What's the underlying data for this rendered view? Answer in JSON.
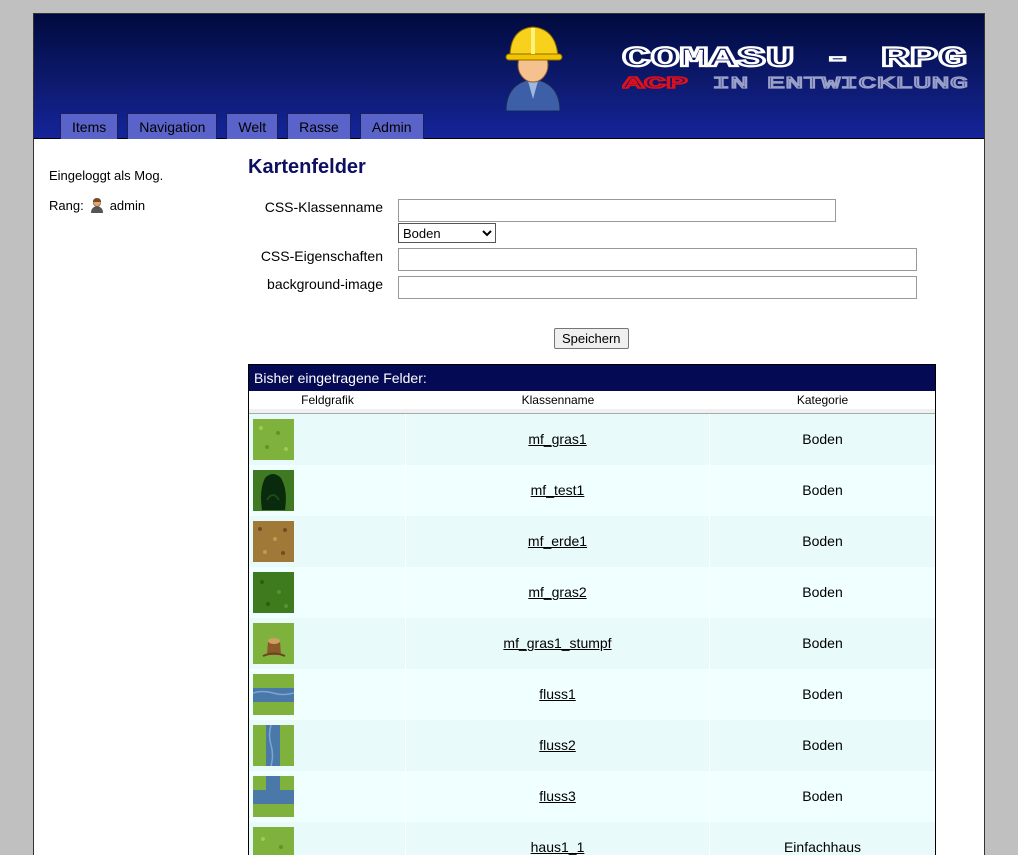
{
  "header": {
    "title": "COMASU - RPG",
    "subtitle_acp": "ACP",
    "subtitle_status": "IN ENTWICKLUNG"
  },
  "nav": {
    "items": [
      "Items",
      "Navigation",
      "Welt",
      "Rasse",
      "Admin"
    ]
  },
  "sidebar": {
    "login_text": "Eingeloggt als Mog.",
    "rank_label": "Rang:",
    "rank_value": "admin"
  },
  "main": {
    "title": "Kartenfelder",
    "form": {
      "css_class_label": "CSS-Klassenname",
      "css_class_value": "",
      "category_selected": "Boden",
      "css_props_label": "CSS-Eigenschaften",
      "css_props_value": "",
      "bg_image_label": "background-image",
      "bg_image_value": "",
      "save_label": "Speichern"
    },
    "table": {
      "caption": "Bisher eingetragene Felder:",
      "columns": [
        "Feldgrafik",
        "Klassenname",
        "Kategorie"
      ],
      "rows": [
        {
          "class_name": "mf_gras1",
          "category": "Boden",
          "tile": "grass"
        },
        {
          "class_name": "mf_test1",
          "category": "Boden",
          "tile": "dark-tree"
        },
        {
          "class_name": "mf_erde1",
          "category": "Boden",
          "tile": "dirt"
        },
        {
          "class_name": "mf_gras2",
          "category": "Boden",
          "tile": "dark-grass"
        },
        {
          "class_name": "mf_gras1_stumpf",
          "category": "Boden",
          "tile": "grass-stump"
        },
        {
          "class_name": "fluss1",
          "category": "Boden",
          "tile": "river-horizontal"
        },
        {
          "class_name": "fluss2",
          "category": "Boden",
          "tile": "river-vertical"
        },
        {
          "class_name": "fluss3",
          "category": "Boden",
          "tile": "river-corner"
        },
        {
          "class_name": "haus1_1",
          "category": "Einfachhaus",
          "tile": "house-grass"
        }
      ]
    }
  },
  "colors": {
    "header_dark": "#000a3e",
    "tab_bg": "#5a63c9",
    "title_color": "#0d1060",
    "table_bar": "#050a55",
    "row_bg": "#f0ffff"
  }
}
